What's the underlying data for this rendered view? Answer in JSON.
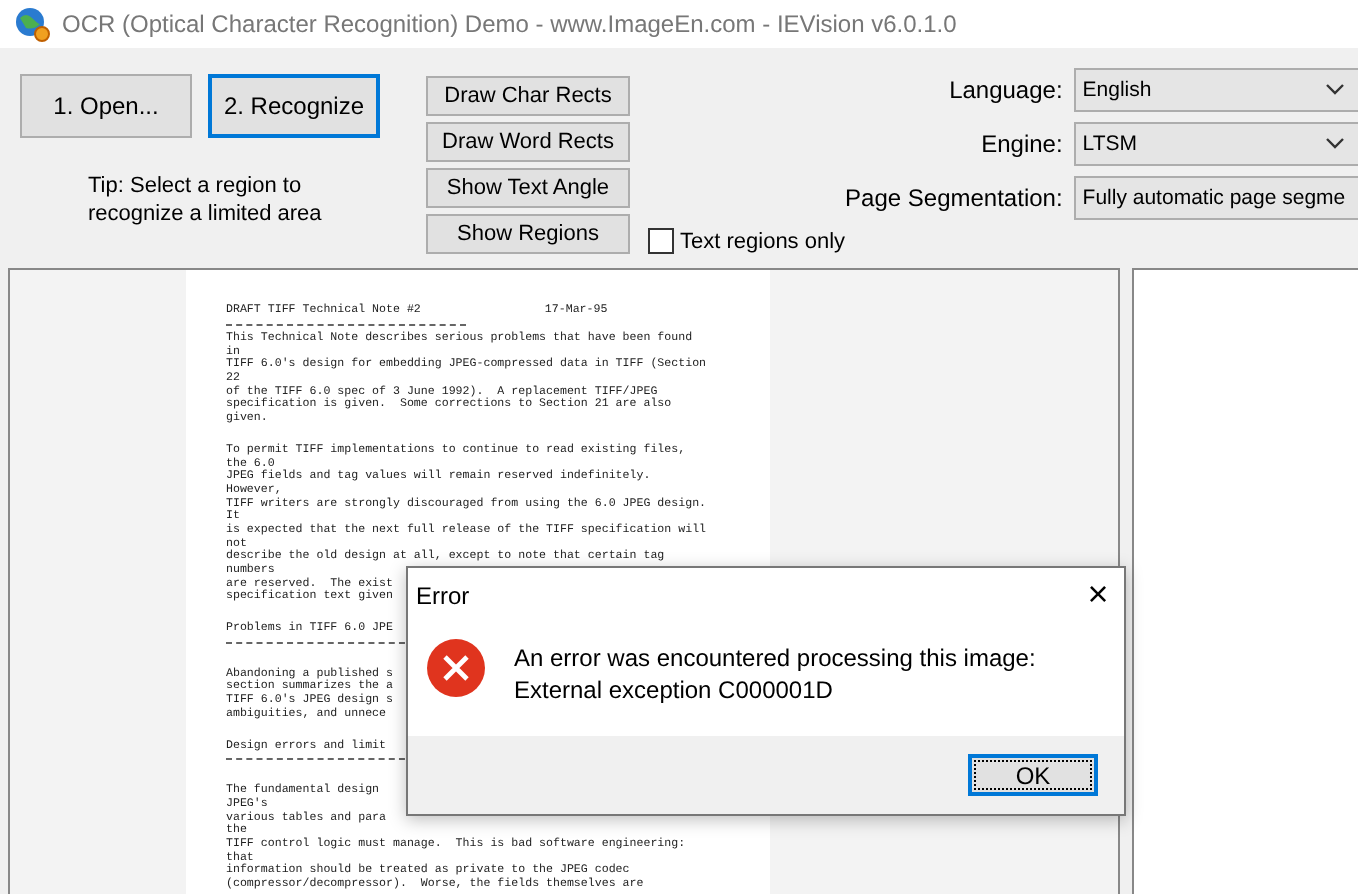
{
  "window": {
    "title": "OCR (Optical Character Recognition) Demo - www.ImageEn.com - IEVision v6.0.1.0"
  },
  "main_buttons": [
    {
      "label": "1. Open...",
      "default": false
    },
    {
      "label": "2. Recognize",
      "default": true
    }
  ],
  "tip": "Tip: Select a region to recognize a limited area",
  "view_buttons": [
    "Draw Char Rects",
    "Draw Word Rects",
    "Show Text Angle",
    "Show Regions"
  ],
  "text_regions_only": {
    "label": "Text regions only",
    "checked": false
  },
  "settings": [
    {
      "label": "Language:",
      "value": "English"
    },
    {
      "label": "Engine:",
      "value": "LTSM"
    },
    {
      "label": "Page Segmentation:",
      "value": "Fully automatic page segme"
    }
  ],
  "document_lines": [
    {
      "kind": "header",
      "text": "DRAFT TIFF Technical Note #2",
      "date": "17-Mar-95"
    },
    {
      "kind": "rule"
    },
    {
      "kind": "text",
      "text": "This Technical Note describes serious problems that have been found"
    },
    {
      "kind": "text",
      "text": "in"
    },
    {
      "kind": "text",
      "text": "TIFF 6.0's design for embedding JPEG-compressed data in TIFF (Section"
    },
    {
      "kind": "text",
      "text": "22"
    },
    {
      "kind": "text",
      "text": "of the TIFF 6.0 spec of 3 June 1992).  A replacement TIFF/JPEG"
    },
    {
      "kind": "text",
      "text": "specification is given.  Some corrections to Section 21 are also"
    },
    {
      "kind": "text",
      "text": "given."
    },
    {
      "kind": "gap"
    },
    {
      "kind": "text",
      "text": "To permit TIFF implementations to continue to read existing files,"
    },
    {
      "kind": "text",
      "text": "the 6.0"
    },
    {
      "kind": "text",
      "text": "JPEG fields and tag values will remain reserved indefinitely."
    },
    {
      "kind": "text",
      "text": "However,"
    },
    {
      "kind": "text",
      "text": "TIFF writers are strongly discouraged from using the 6.0 JPEG design."
    },
    {
      "kind": "text",
      "text": "It"
    },
    {
      "kind": "text",
      "text": "is expected that the next full release of the TIFF specification will"
    },
    {
      "kind": "text",
      "text": "not"
    },
    {
      "kind": "text",
      "text": "describe the old design at all, except to note that certain tag"
    },
    {
      "kind": "text",
      "text": "numbers"
    },
    {
      "kind": "text",
      "text": "are reserved.  The exist"
    },
    {
      "kind": "text",
      "text": "specification text given"
    },
    {
      "kind": "gap"
    },
    {
      "kind": "text",
      "text": "Problems in TIFF 6.0 JPE"
    },
    {
      "kind": "rule"
    },
    {
      "kind": "gap"
    },
    {
      "kind": "text",
      "text": "Abandoning a published s"
    },
    {
      "kind": "text",
      "text": "section summarizes the a"
    },
    {
      "kind": "text",
      "text": "TIFF 6.0's JPEG design s"
    },
    {
      "kind": "text",
      "text": "ambiguities, and unnece"
    },
    {
      "kind": "gap"
    },
    {
      "kind": "text",
      "text": "Design errors and limit"
    },
    {
      "kind": "rule"
    },
    {
      "kind": "gap"
    },
    {
      "kind": "text",
      "text": "The fundamental design"
    },
    {
      "kind": "text",
      "text": "JPEG's"
    },
    {
      "kind": "text",
      "text": "various tables and para"
    },
    {
      "kind": "text",
      "text": "the"
    },
    {
      "kind": "text",
      "text": "TIFF control logic must manage.  This is bad software engineering:"
    },
    {
      "kind": "text",
      "text": "that"
    },
    {
      "kind": "text",
      "text": "information should be treated as private to the JPEG codec"
    },
    {
      "kind": "text",
      "text": "(compressor/decompressor).  Worse, the fields themselves are"
    }
  ],
  "dialog": {
    "title": "Error",
    "close": "×",
    "message": [
      "An error was encountered processing this image:",
      "External exception C000001D"
    ],
    "buttons": [
      {
        "label": "OK",
        "default": true
      }
    ]
  }
}
